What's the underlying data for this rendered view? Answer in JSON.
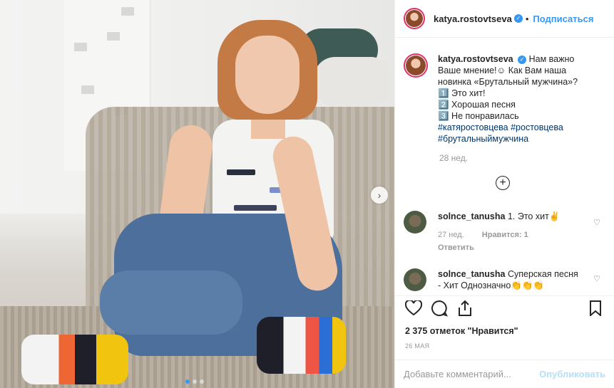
{
  "post": {
    "username": "katya.rostovtseva",
    "separator": "•",
    "follow_label": "Подписаться",
    "verified_icon": "verified-badge-icon",
    "photo_alt": "photo-of-woman-sitting-on-bed"
  },
  "caption": {
    "username": "katya.rostovtseva",
    "lines": [
      "Нам важно",
      "Ваше мнение!☺ Как Вам наша",
      "новинка «Брутальный мужчина»?",
      "1️⃣ Это хит!",
      "2️⃣ Хорошая песня",
      "3️⃣ Не понравилась"
    ],
    "hashtags": [
      "#катяростовцева",
      "#ростовцева",
      "#брутальныймужчина"
    ],
    "age": "28 нед."
  },
  "comments": [
    {
      "user": "solnce_tanusha",
      "text": "1. Это хит✌",
      "age": "27 нед.",
      "likes": "Нравится: 1",
      "reply": "Ответить"
    },
    {
      "user": "solnce_tanusha",
      "text": "Суперская песня - Хит Однозначно👏👏👏"
    }
  ],
  "likes_text": "2 375 отметок \"Нравится\"",
  "date_text": "26 МАЯ",
  "add_comment": {
    "placeholder": "Добавьте комментарий...",
    "publish": "Опубликовать"
  },
  "colors": {
    "accent": "#3897f0",
    "ring": "#e1306c",
    "publish_disabled": "#b2dffc"
  },
  "carousel": {
    "slides": 3,
    "active": 1
  }
}
